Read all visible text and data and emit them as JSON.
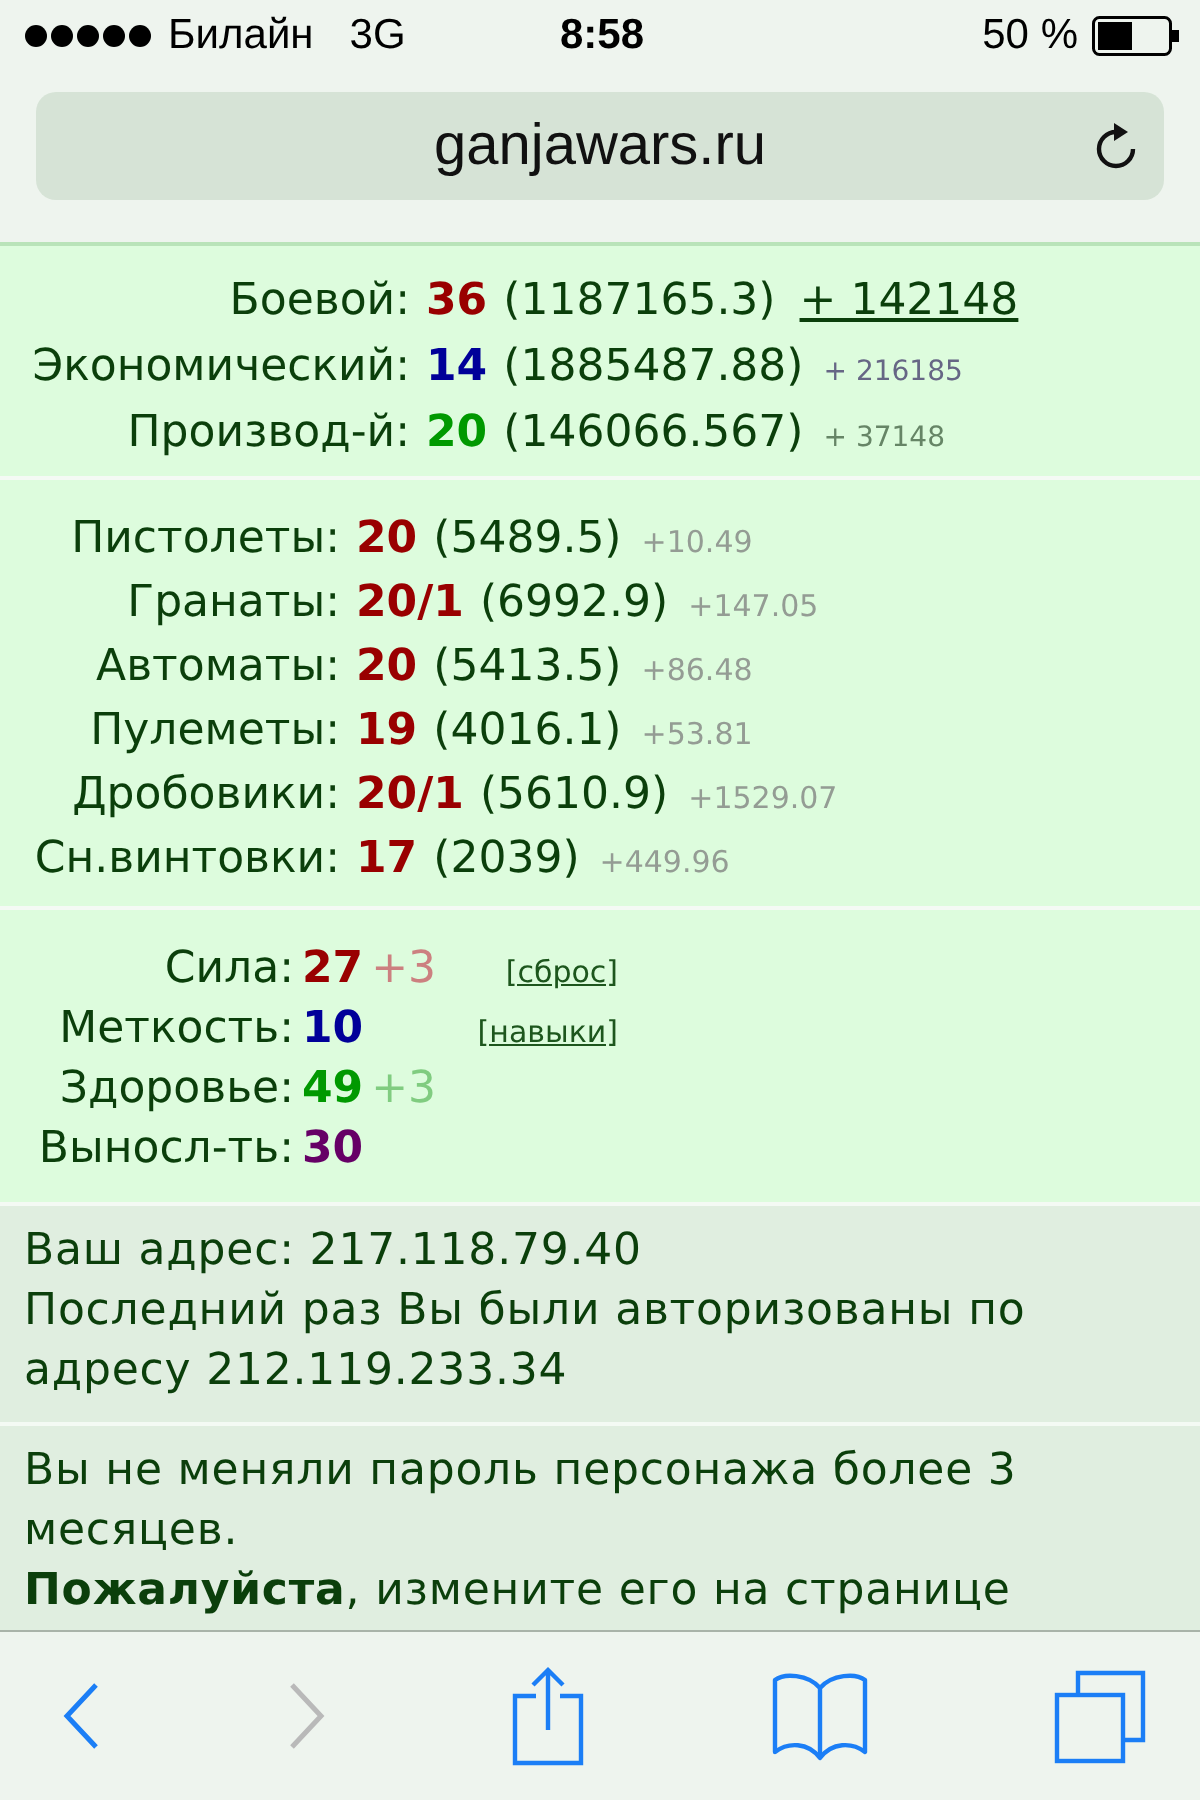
{
  "status_bar": {
    "carrier": "Билайн",
    "network": "3G",
    "time": "8:58",
    "battery": "50 %"
  },
  "address_bar": {
    "url": "ganjawars.ru"
  },
  "levels": [
    {
      "label": "Боевой:",
      "value": "36",
      "color": "#990000",
      "total": "(1187165.3)",
      "gain": "+ 142148",
      "kind": "link"
    },
    {
      "label": "Экономический:",
      "value": "14",
      "color": "#000099",
      "total": "(1885487.88)",
      "gain": "+ 216185",
      "kind": "note"
    },
    {
      "label": "Производ-й:",
      "value": "20",
      "color": "#009900",
      "total": "(146066.567)",
      "gain": "+ 37148",
      "kind": "note"
    }
  ],
  "weapons": [
    {
      "label": "Пистолеты:",
      "value": "20",
      "total": "(5489.5)",
      "gain": "+10.49"
    },
    {
      "label": "Гранаты:",
      "value": "20/1",
      "total": "(6992.9)",
      "gain": "+147.05"
    },
    {
      "label": "Автоматы:",
      "value": "20",
      "total": "(5413.5)",
      "gain": "+86.48"
    },
    {
      "label": "Пулеметы:",
      "value": "19",
      "total": "(4016.1)",
      "gain": "+53.81"
    },
    {
      "label": "Дробовики:",
      "value": "20/1",
      "total": "(5610.9)",
      "gain": "+1529.07"
    },
    {
      "label": "Сн.винтовки:",
      "value": "17",
      "total": "(2039)",
      "gain": "+449.96"
    }
  ],
  "skills": [
    {
      "label": "Сила:",
      "value": "27",
      "color": "#990000",
      "bonus": "+3",
      "link": "[сброс]"
    },
    {
      "label": "Меткость:",
      "value": "10",
      "color": "#000099",
      "link": "[навыки]"
    },
    {
      "label": "Здоровье:",
      "value": "49",
      "color": "#009900",
      "bonus": "+3"
    },
    {
      "label": "Выносл-ть:",
      "value": "30",
      "color": "#660066"
    }
  ],
  "notices": [
    {
      "lines": [
        "Ваш адрес: 217.118.79.40",
        "Последний раз Вы были авторизованы по адресу 212.119.233.34"
      ]
    },
    {
      "lines": [
        "Вы не меняли пароль персонажа более 3 месяцев.",
        "**Пожалуйста**, измените его на странице"
      ]
    }
  ],
  "toolbar": [
    {
      "kind": "back",
      "disabled": false
    },
    {
      "kind": "forward",
      "disabled": true
    },
    {
      "kind": "share",
      "disabled": false
    },
    {
      "kind": "bookmarks",
      "disabled": false
    },
    {
      "kind": "tabs",
      "disabled": false
    }
  ]
}
